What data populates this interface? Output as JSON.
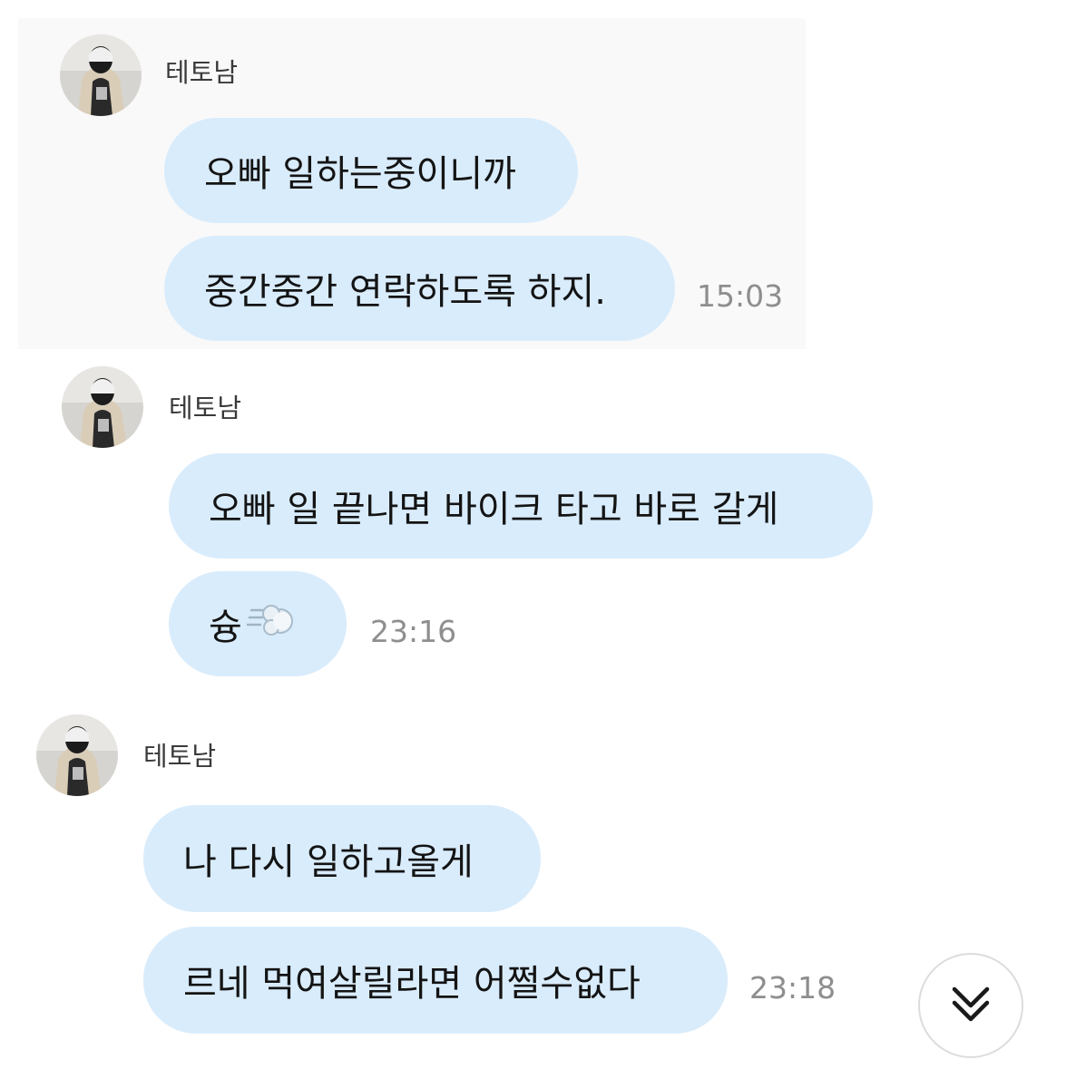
{
  "messages": [
    {
      "sender": "테토남",
      "avatar_icon": "profile-photo",
      "bubbles": [
        "오빠 일하는중이니까",
        "중간중간 연락하도록 하지."
      ],
      "time": "15:03"
    },
    {
      "sender": "테토남",
      "avatar_icon": "profile-photo",
      "bubbles": [
        "오빠 일 끝나면 바이크 타고 바로 갈게",
        "슝"
      ],
      "emoji": "dash-emoji",
      "time": "23:16"
    },
    {
      "sender": "테토남",
      "avatar_icon": "profile-photo",
      "bubbles": [
        "나 다시 일하고올게",
        "르네 먹여살릴라면 어쩔수없다"
      ],
      "time": "23:18"
    }
  ],
  "scroll_button": {
    "icon": "double-chevron-down-icon"
  },
  "colors": {
    "bubble": "#d9ecfc",
    "time_text": "#8e8e8e",
    "name_text": "#3a3a3a"
  }
}
